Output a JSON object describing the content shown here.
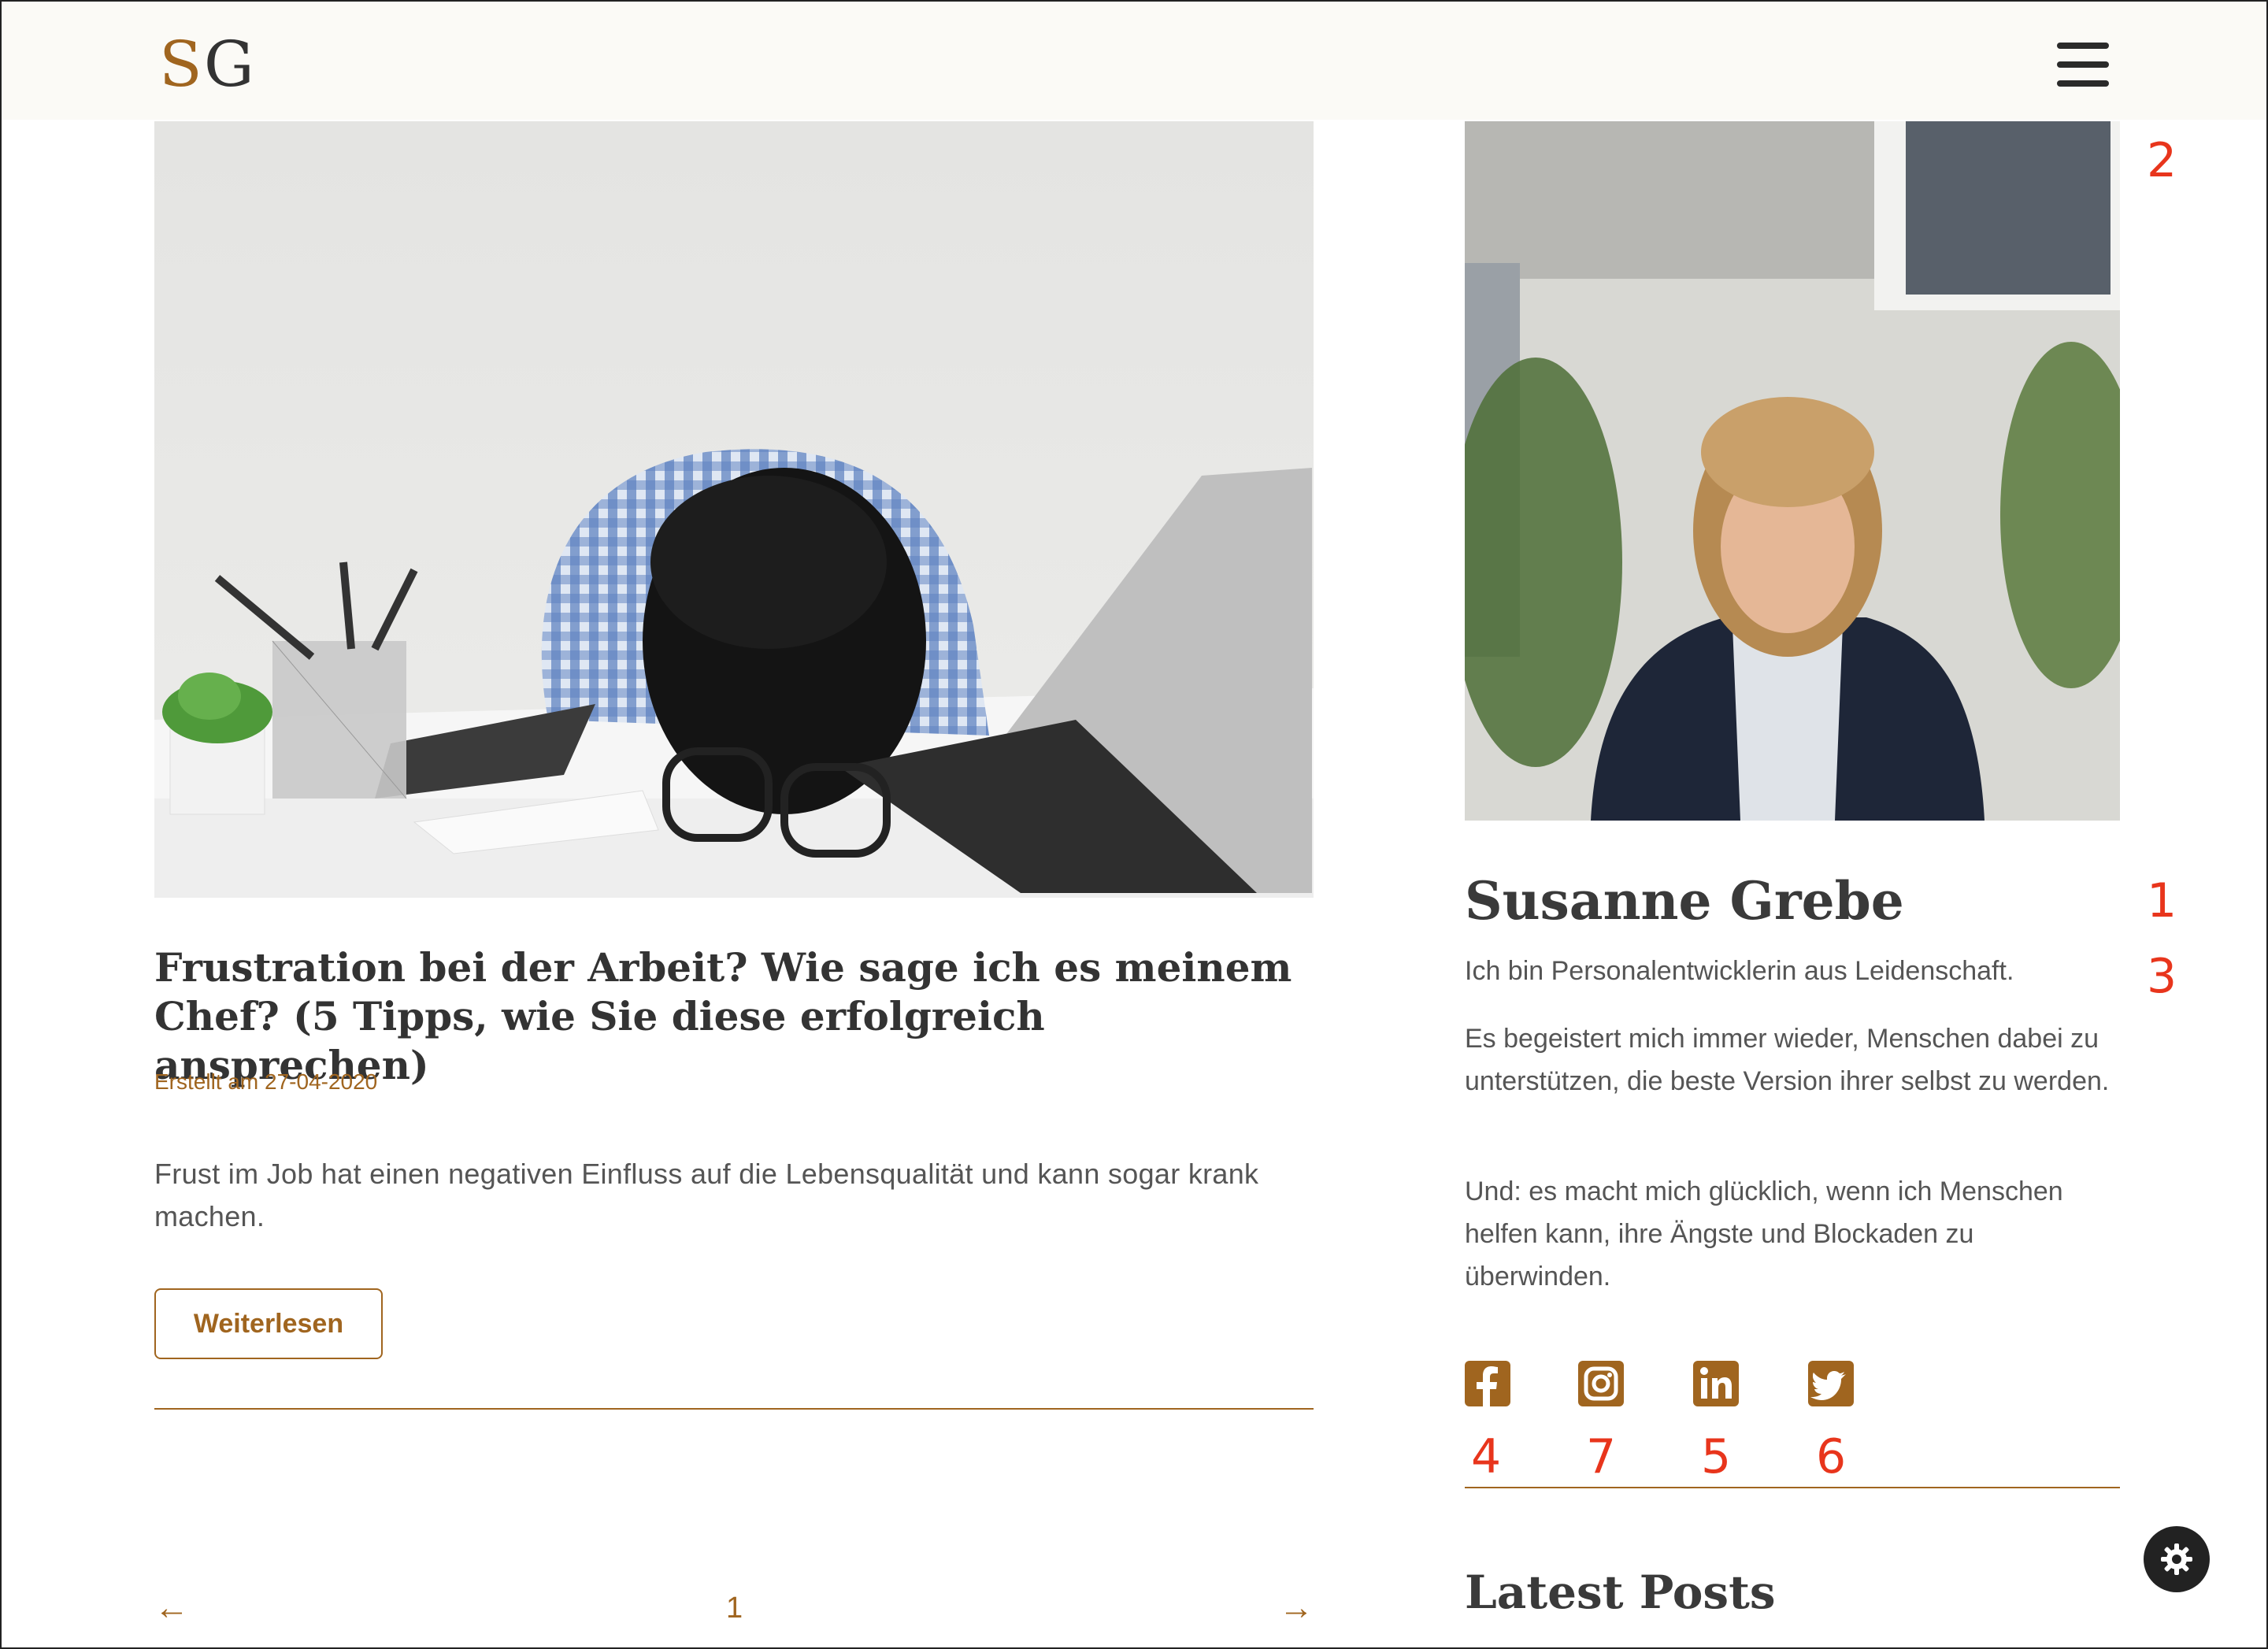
{
  "header": {
    "logo_s": "S",
    "logo_g": "G",
    "menu_icon": "hamburger-icon"
  },
  "article": {
    "title": "Frustration bei der Arbeit? Wie sage ich es meinem Chef? (5 Tipps, wie Sie diese erfolgreich ansprechen)",
    "date": "Erstellt am 27-04-2020",
    "excerpt": "Frust im Job hat einen negativen Einfluss auf die Lebensqualität und kann sogar krank machen.",
    "read_more": "Weiterlesen"
  },
  "pagination": {
    "prev": "←",
    "page": "1",
    "next": "→"
  },
  "sidebar": {
    "name": "Susanne Grebe",
    "paragraphs": [
      "Ich bin Personalentwicklerin aus Leidenschaft.",
      "Es begeistert mich immer wieder, Menschen dabei zu unterstützen, die beste Version ihrer selbst zu werden.",
      "Und: es macht mich glücklich, wenn ich Menschen helfen kann, ihre Ängste und Blockaden zu überwinden."
    ],
    "social": [
      "facebook-icon",
      "instagram-icon",
      "linkedin-icon",
      "twitter-icon"
    ],
    "latest_heading": "Latest Posts"
  },
  "annotations": {
    "name": "1",
    "image": "2",
    "bio": "3",
    "facebook": "4",
    "linkedin": "5",
    "twitter": "6",
    "instagram": "7"
  },
  "colors": {
    "accent": "#a0651f",
    "annotation": "#e8351c",
    "header_bg": "#fbfaf6"
  }
}
